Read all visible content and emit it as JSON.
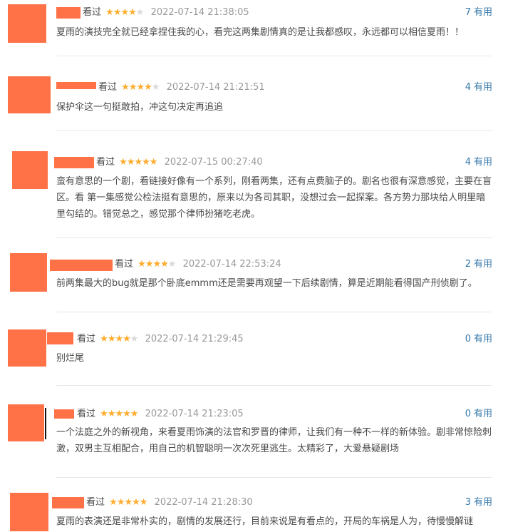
{
  "colors": {
    "accent": "#ff7248",
    "star": "#ffac2d",
    "link": "#3377aa"
  },
  "reviews": [
    {
      "status": "看过",
      "rating": 4,
      "time": "2022-07-14 21:38:05",
      "votes": "7",
      "votes_label": "有用",
      "content": "夏雨的演技完全就已经拿捏住我的心，看完这两集剧情真的是让我都感叹，永远都可以相信夏雨！！"
    },
    {
      "status": "看过",
      "rating": 4,
      "time": "2022-07-14 21:21:51",
      "votes": "4",
      "votes_label": "有用",
      "content": "保护伞这一句挺敢拍，冲这句决定再追追"
    },
    {
      "status": "看过",
      "rating": 5,
      "time": "2022-07-15 00:27:40",
      "votes": "4",
      "votes_label": "有用",
      "content": "蛮有意思的一个剧，看链接好像有一个系列，刚看两集，还有点费脑子的。剧名也很有深意感觉，主要在盲区。看 第一集感觉公检法挺有意思的，原来以为各司其职，没想过会一起探案。各方势力那块给人明里暗里勾结的。错觉总之，感觉那个律师扮猪吃老虎。"
    },
    {
      "status": "看过",
      "rating": 4,
      "time": "2022-07-14 22:53:24",
      "votes": "2",
      "votes_label": "有用",
      "content": "前两集最大的bug就是那个卧底emmm还是需要再观望一下后续剧情，算是近期能看得国产刑侦剧了。"
    },
    {
      "status": "看过",
      "rating": 4,
      "time": "2022-07-14 21:29:45",
      "votes": "0",
      "votes_label": "有用",
      "content": "别烂尾"
    },
    {
      "status": "看过",
      "rating": 5,
      "time": "2022-07-14 21:23:05",
      "votes": "0",
      "votes_label": "有用",
      "content": "一个法庭之外的新视角，来看夏雨饰演的法官和罗晋的律师，让我们有一种不一样的新体验。剧非常惊险刺激，双男主互相配合，用自己的机智聪明一次次死里逃生。太精彩了，大爱悬疑剧场"
    },
    {
      "status": "看过",
      "rating": 5,
      "time": "2022-07-14 21:28:30",
      "votes": "3",
      "votes_label": "有用",
      "content": "夏雨的表演还是非常朴实的，剧情的发展还行，目前来说是有看点的，开局的车祸是人为，待慢慢解谜"
    }
  ]
}
